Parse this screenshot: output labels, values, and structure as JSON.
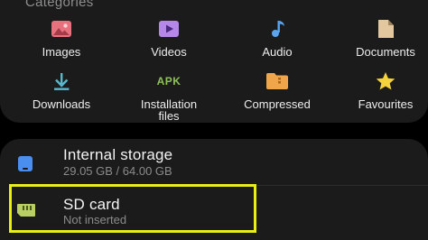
{
  "categories": {
    "header": "Categories",
    "items": [
      {
        "label": "Images",
        "icon": "image-icon",
        "color": "#e8717e"
      },
      {
        "label": "Videos",
        "icon": "video-icon",
        "color": "#b487e8"
      },
      {
        "label": "Audio",
        "icon": "music-note-icon",
        "color": "#5ba4ef"
      },
      {
        "label": "Documents",
        "icon": "document-icon",
        "color": "#e3c79f"
      },
      {
        "label": "Downloads",
        "icon": "download-icon",
        "color": "#58b9cc"
      },
      {
        "label": "Installation\nfiles",
        "icon": "apk-icon",
        "icon_text": "APK",
        "color": "#8dc356"
      },
      {
        "label": "Compressed",
        "icon": "folder-zip-icon",
        "color": "#f0a54a"
      },
      {
        "label": "Favourites",
        "icon": "star-icon",
        "color": "#f4d23e"
      }
    ]
  },
  "storage": {
    "internal": {
      "title": "Internal storage",
      "subtitle": "29.05 GB / 64.00 GB",
      "icon": "phone-storage-icon",
      "color": "#4a8ff0"
    },
    "sd": {
      "title": "SD card",
      "subtitle": "Not inserted",
      "icon": "sd-card-icon",
      "color": "#b9cf63"
    }
  },
  "highlight_color": "#e7ef14"
}
